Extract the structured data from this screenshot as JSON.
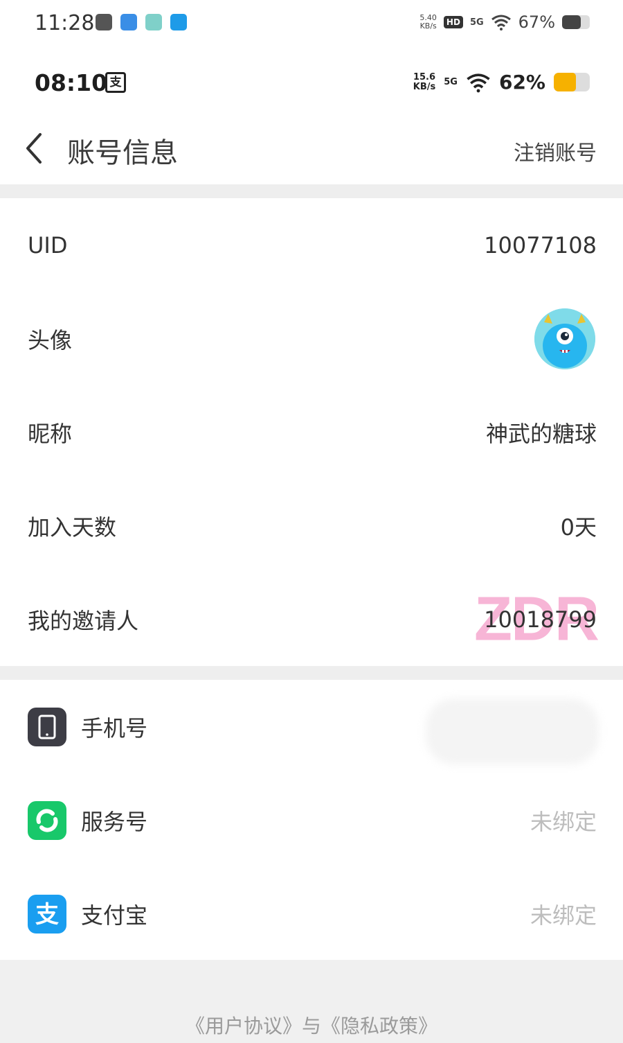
{
  "status_bar_outer": {
    "time": "11:28",
    "speed": [
      "5.40",
      "KB/s"
    ],
    "hd": "HD",
    "network": "5G",
    "battery": "67%",
    "battery_level": 0.67
  },
  "status_bar_inner": {
    "time": "08:10",
    "badge": "支",
    "speed": [
      "15.6",
      "KB/s"
    ],
    "network": "5G",
    "battery": "62%",
    "battery_level": 0.62,
    "battery_color": "#f6b100"
  },
  "header": {
    "title": "账号信息",
    "action": "注销账号"
  },
  "account": {
    "uid_label": "UID",
    "uid_value": "10077108",
    "avatar_label": "头像",
    "nickname_label": "昵称",
    "nickname_value": "神武的糖球",
    "days_label": "加入天数",
    "days_value": "0天",
    "inviter_label": "我的邀请人",
    "inviter_value": "10018799",
    "watermark": "ZDR"
  },
  "bindings": {
    "phone_label": "手机号",
    "service_label": "服务号",
    "service_value": "未绑定",
    "alipay_label": "支付宝",
    "alipay_value": "未绑定"
  },
  "footer": {
    "links": "《用户协议》与《隐私政策》"
  }
}
